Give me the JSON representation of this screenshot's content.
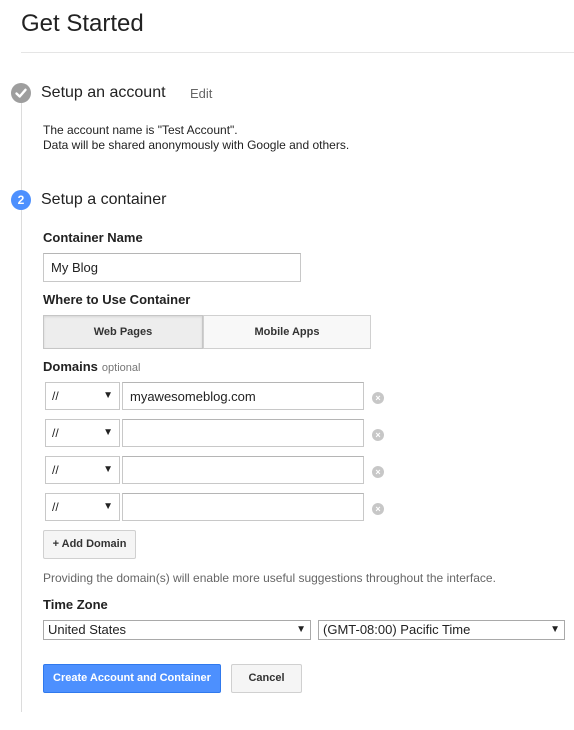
{
  "page": {
    "title": "Get Started"
  },
  "step1": {
    "title": "Setup an account",
    "edit_label": "Edit",
    "info_line1": "The account name is \"Test Account\".",
    "info_line2": "Data will be shared anonymously with Google and others."
  },
  "step2": {
    "number": "2",
    "title": "Setup a container",
    "container_name_label": "Container Name",
    "container_name_value": "My Blog",
    "where_label": "Where to Use Container",
    "tabs": [
      {
        "label": "Web Pages",
        "selected": true
      },
      {
        "label": "Mobile Apps",
        "selected": false
      }
    ],
    "domains_label": "Domains",
    "domains_optional": "optional",
    "domains": [
      {
        "protocol": "//",
        "value": "myawesomeblog.com"
      },
      {
        "protocol": "//",
        "value": ""
      },
      {
        "protocol": "//",
        "value": ""
      },
      {
        "protocol": "//",
        "value": ""
      }
    ],
    "add_domain_label": "+ Add Domain",
    "domains_hint": "Providing the domain(s) will enable more useful suggestions throughout the interface.",
    "timezone_label": "Time Zone",
    "timezone_country": "United States",
    "timezone_zone": "(GMT-08:00) Pacific Time"
  },
  "actions": {
    "create_label": "Create Account and Container",
    "cancel_label": "Cancel"
  },
  "icons": {
    "step_done": "checkmark-icon",
    "remove": "remove-circle-icon",
    "dropdown": "chevron-down-icon"
  },
  "colors": {
    "primary": "#4d90fe",
    "step_done": "#9e9e9e"
  }
}
